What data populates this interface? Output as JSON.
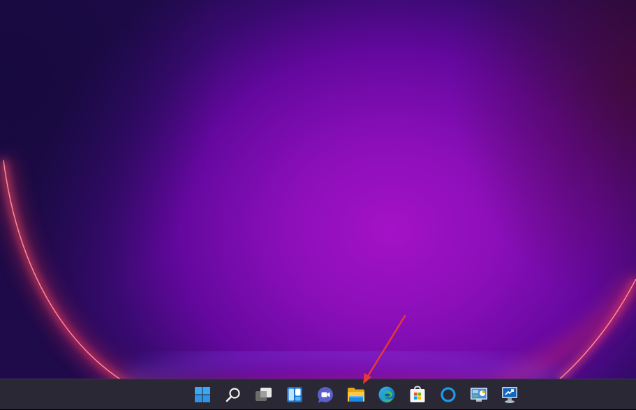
{
  "desktop": {
    "wallpaper": "windows-11-bloom-purple",
    "colors": {
      "center": "#a412c6",
      "mid": "#64089f",
      "edge": "#1f0a4a",
      "arc": "#ff4a5a"
    }
  },
  "taskbar": {
    "background": "#2a2834",
    "items": [
      {
        "name": "start-button",
        "icon": "windows-logo-icon"
      },
      {
        "name": "search-button",
        "icon": "search-icon"
      },
      {
        "name": "task-view-button",
        "icon": "task-view-icon"
      },
      {
        "name": "widgets-button",
        "icon": "widgets-icon"
      },
      {
        "name": "chat-button",
        "icon": "teams-chat-icon"
      },
      {
        "name": "file-explorer-button",
        "icon": "folder-icon"
      },
      {
        "name": "edge-button",
        "icon": "edge-icon"
      },
      {
        "name": "store-button",
        "icon": "store-icon"
      },
      {
        "name": "cortana-button",
        "icon": "cortana-icon"
      },
      {
        "name": "control-panel-button",
        "icon": "control-panel-icon"
      },
      {
        "name": "remote-desktop-button",
        "icon": "remote-desktop-icon"
      }
    ]
  },
  "annotation": {
    "arrow_color": "#e53935",
    "points_to": "file-explorer-button"
  }
}
